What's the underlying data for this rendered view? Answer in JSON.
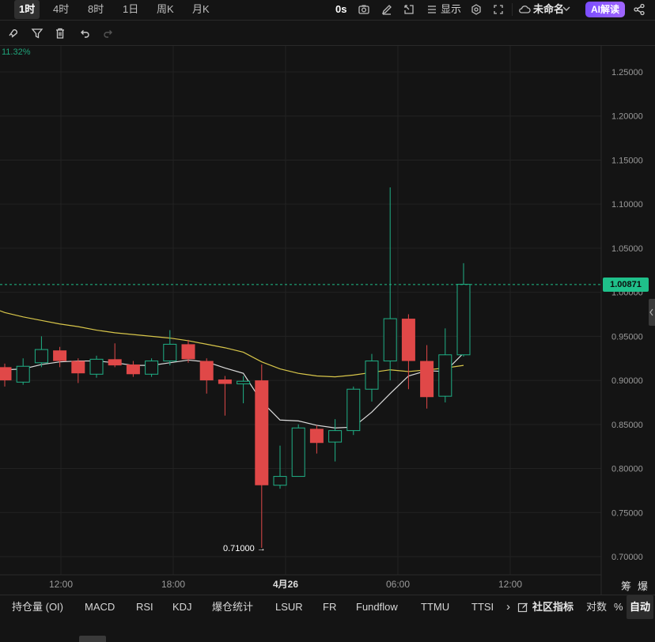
{
  "toolbar": {
    "timeframes": [
      "1时",
      "4时",
      "8时",
      "1日",
      "周K",
      "月K"
    ],
    "active_timeframe": "1时",
    "countdown": "0s",
    "display_label": "显示",
    "layout_name": "未命名",
    "ai_label": "AI解读"
  },
  "drawing_tools": [
    "magnet-icon",
    "filter-icon",
    "trash-icon",
    "undo-icon",
    "redo-icon"
  ],
  "chart": {
    "change_percent": "11.32%",
    "current_price_label": "1.00871",
    "low_label": "0.71000",
    "colors": {
      "up": "#1fb086",
      "down": "#e04848",
      "ma_white": "#dcdcdc",
      "ma_yellow": "#d8c64a",
      "price_line": "#1fc08a"
    }
  },
  "chart_data": {
    "type": "candlestick",
    "y_ticks": [
      "1.25000",
      "1.20000",
      "1.15000",
      "1.10000",
      "1.05000",
      "1.00000",
      "0.95000",
      "0.90000",
      "0.85000",
      "0.80000",
      "0.75000",
      "0.70000"
    ],
    "x_ticks": [
      "12:00",
      "18:00",
      "4月26",
      "06:00",
      "12:00"
    ],
    "ylim": [
      0.695,
      1.265
    ],
    "candles": [
      {
        "o": 0.915,
        "h": 0.919,
        "l": 0.893,
        "c": 0.9
      },
      {
        "o": 0.898,
        "h": 0.925,
        "l": 0.895,
        "c": 0.916
      },
      {
        "o": 0.92,
        "h": 0.95,
        "l": 0.915,
        "c": 0.935
      },
      {
        "o": 0.934,
        "h": 0.938,
        "l": 0.915,
        "c": 0.922
      },
      {
        "o": 0.922,
        "h": 0.925,
        "l": 0.897,
        "c": 0.908
      },
      {
        "o": 0.907,
        "h": 0.928,
        "l": 0.903,
        "c": 0.924
      },
      {
        "o": 0.924,
        "h": 0.942,
        "l": 0.915,
        "c": 0.917
      },
      {
        "o": 0.918,
        "h": 0.922,
        "l": 0.904,
        "c": 0.907
      },
      {
        "o": 0.907,
        "h": 0.925,
        "l": 0.904,
        "c": 0.922
      },
      {
        "o": 0.922,
        "h": 0.957,
        "l": 0.917,
        "c": 0.941
      },
      {
        "o": 0.941,
        "h": 0.946,
        "l": 0.92,
        "c": 0.924
      },
      {
        "o": 0.922,
        "h": 0.925,
        "l": 0.885,
        "c": 0.9
      },
      {
        "o": 0.901,
        "h": 0.905,
        "l": 0.86,
        "c": 0.896
      },
      {
        "o": 0.896,
        "h": 0.905,
        "l": 0.874,
        "c": 0.899
      },
      {
        "o": 0.9,
        "h": 0.918,
        "l": 0.71,
        "c": 0.781
      },
      {
        "o": 0.781,
        "h": 0.826,
        "l": 0.777,
        "c": 0.791
      },
      {
        "o": 0.791,
        "h": 0.85,
        "l": 0.791,
        "c": 0.846
      },
      {
        "o": 0.845,
        "h": 0.849,
        "l": 0.817,
        "c": 0.829
      },
      {
        "o": 0.83,
        "h": 0.856,
        "l": 0.808,
        "c": 0.843
      },
      {
        "o": 0.843,
        "h": 0.893,
        "l": 0.838,
        "c": 0.89
      },
      {
        "o": 0.89,
        "h": 0.93,
        "l": 0.876,
        "c": 0.922
      },
      {
        "o": 0.922,
        "h": 1.119,
        "l": 0.9,
        "c": 0.97
      },
      {
        "o": 0.97,
        "h": 0.975,
        "l": 0.89,
        "c": 0.922
      },
      {
        "o": 0.922,
        "h": 0.94,
        "l": 0.868,
        "c": 0.881
      },
      {
        "o": 0.882,
        "h": 0.959,
        "l": 0.875,
        "c": 0.929
      },
      {
        "o": 0.929,
        "h": 1.033,
        "l": 0.927,
        "c": 1.009
      }
    ],
    "ma_white": [
      0.912,
      0.913,
      0.918,
      0.921,
      0.922,
      0.922,
      0.92,
      0.917,
      0.917,
      0.92,
      0.923,
      0.921,
      0.914,
      0.908,
      0.876,
      0.855,
      0.854,
      0.849,
      0.846,
      0.847,
      0.864,
      0.885,
      0.905,
      0.911,
      0.91,
      0.931
    ],
    "ma_yellow": {
      "x_start": 0,
      "values": [
        0.977,
        0.972,
        0.968,
        0.964,
        0.961,
        0.957,
        0.954,
        0.952,
        0.95,
        0.948,
        0.945,
        0.941,
        0.937,
        0.932,
        0.921,
        0.913,
        0.908,
        0.905,
        0.904,
        0.906,
        0.909,
        0.912,
        0.91,
        0.912,
        0.914,
        0.917
      ]
    }
  },
  "bottom": {
    "indicators": [
      "持仓量 (OI)",
      "MACD",
      "RSI",
      "KDJ",
      "爆仓统计",
      "LSUR",
      "FR",
      "Fundflow",
      "TTMU",
      "TTSI"
    ],
    "more": "›",
    "community": "社区指标",
    "scale_log": "对数",
    "scale_pct": "%",
    "scale_auto": "自动",
    "axis_corner_1": "筹",
    "axis_corner_2": "爆"
  }
}
